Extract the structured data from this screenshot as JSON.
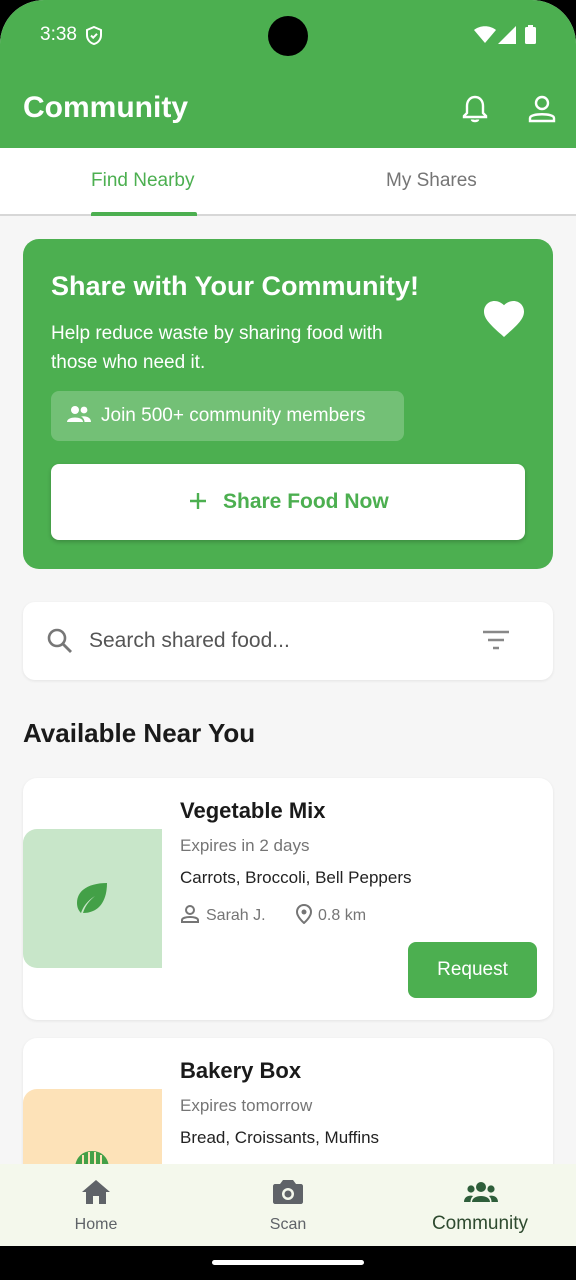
{
  "status_bar": {
    "time": "3:38"
  },
  "appbar": {
    "title": "Community"
  },
  "tabs": [
    {
      "label": "Find Nearby",
      "active": true
    },
    {
      "label": "My Shares",
      "active": false
    }
  ],
  "hero": {
    "title": "Share with Your Community!",
    "description": "Help reduce waste by sharing food with those who need it.",
    "chip_text": "Join 500+ community members",
    "button_label": "Share Food Now"
  },
  "search": {
    "placeholder": "Search shared food..."
  },
  "section": {
    "title": "Available Near You"
  },
  "listings": [
    {
      "name": "Vegetable Mix",
      "expires": "Expires in 2 days",
      "items": "Carrots, Broccoli, Bell Peppers",
      "user": "Sarah J.",
      "distance": "0.8 km",
      "button_label": "Request",
      "thumb_icon": "leaf-icon",
      "thumb_color": "#c8e6c9"
    },
    {
      "name": "Bakery Box",
      "expires": "Expires tomorrow",
      "items": "Bread, Croissants, Muffins",
      "thumb_icon": "bakery-icon",
      "thumb_color": "#fde2b8"
    }
  ],
  "bottom_nav": [
    {
      "label": "Home",
      "icon": "home-icon",
      "active": false
    },
    {
      "label": "Scan",
      "icon": "camera-icon",
      "active": false
    },
    {
      "label": "Community",
      "icon": "groups-icon",
      "active": true
    }
  ],
  "colors": {
    "primary": "#4caf50",
    "surface": "#ffffff",
    "background": "#f6f6f6"
  }
}
